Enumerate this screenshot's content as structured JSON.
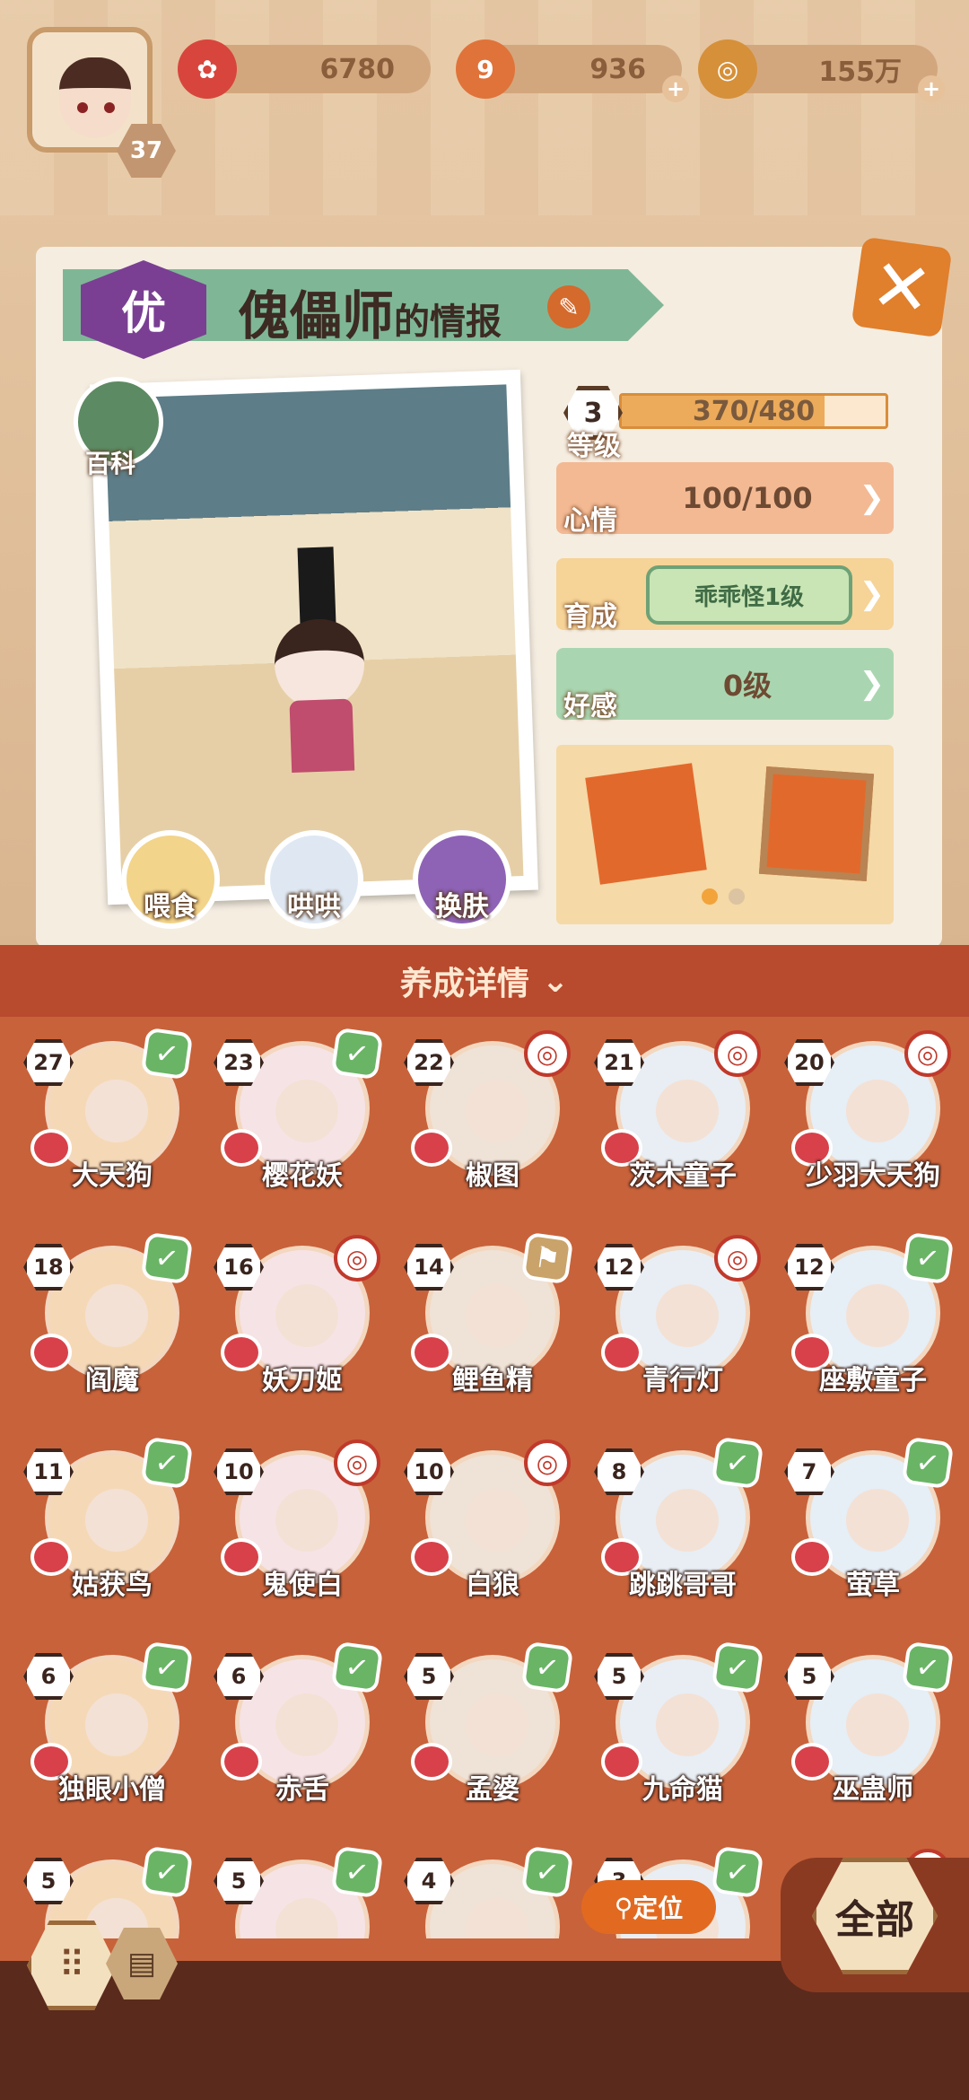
{
  "player": {
    "level": "37"
  },
  "resources": [
    {
      "name": "sakura-coin",
      "value": "6780",
      "icon": "plum-flower-icon",
      "color": "#d8453c"
    },
    {
      "name": "magatama",
      "value": "936",
      "icon": "magatama-icon",
      "color": "#e0733a"
    },
    {
      "name": "gold",
      "value": "155万",
      "icon": "coin-icon",
      "color": "#d6903a"
    }
  ],
  "card": {
    "grade": "优",
    "title": "傀儡师",
    "title_suffix": "的情报",
    "baike": "百科",
    "actions": [
      {
        "label": "喂食",
        "icon": "food-bowl-icon"
      },
      {
        "label": "哄哄",
        "icon": "milk-carton-icon"
      },
      {
        "label": "换肤",
        "icon": "kimono-icon"
      }
    ]
  },
  "stats": {
    "level": {
      "value": "3",
      "label": "等级",
      "exp": "370/480",
      "progress": 0.77
    },
    "mood": {
      "label": "心情",
      "value": "100/100"
    },
    "growth": {
      "label": "育成",
      "value": "乖乖怪1级"
    },
    "affection": {
      "label": "好感",
      "value": "0级"
    }
  },
  "details": {
    "label": "养成详情"
  },
  "pets": [
    {
      "level": "27",
      "name": "大天狗",
      "badge": "check"
    },
    {
      "level": "23",
      "name": "樱花妖",
      "badge": "check"
    },
    {
      "level": "22",
      "name": "椒图",
      "badge": "symbol"
    },
    {
      "level": "21",
      "name": "茨木童子",
      "badge": "symbol"
    },
    {
      "level": "20",
      "name": "少羽大天狗",
      "badge": "symbol"
    },
    {
      "level": "18",
      "name": "阎魔",
      "badge": "check"
    },
    {
      "level": "16",
      "name": "妖刀姬",
      "badge": "symbol"
    },
    {
      "level": "14",
      "name": "鲤鱼精",
      "badge": "flag"
    },
    {
      "level": "12",
      "name": "青行灯",
      "badge": "symbol"
    },
    {
      "level": "12",
      "name": "座敷童子",
      "badge": "check"
    },
    {
      "level": "11",
      "name": "姑获鸟",
      "badge": "check"
    },
    {
      "level": "10",
      "name": "鬼使白",
      "badge": "symbol"
    },
    {
      "level": "10",
      "name": "白狼",
      "badge": "symbol"
    },
    {
      "level": "8",
      "name": "跳跳哥哥",
      "badge": "check"
    },
    {
      "level": "7",
      "name": "萤草",
      "badge": "check"
    },
    {
      "level": "6",
      "name": "独眼小僧",
      "badge": "check"
    },
    {
      "level": "6",
      "name": "赤舌",
      "badge": "check"
    },
    {
      "level": "5",
      "name": "孟婆",
      "badge": "check"
    },
    {
      "level": "5",
      "name": "九命猫",
      "badge": "check"
    },
    {
      "level": "5",
      "name": "巫蛊师",
      "badge": "check"
    },
    {
      "level": "5",
      "name": "",
      "badge": "check"
    },
    {
      "level": "5",
      "name": "",
      "badge": "check"
    },
    {
      "level": "4",
      "name": "",
      "badge": "check"
    },
    {
      "level": "3",
      "name": "",
      "badge": "check"
    },
    {
      "level": "",
      "name": "",
      "badge": "symbol"
    }
  ],
  "locate": "定位",
  "all_label": "全部"
}
